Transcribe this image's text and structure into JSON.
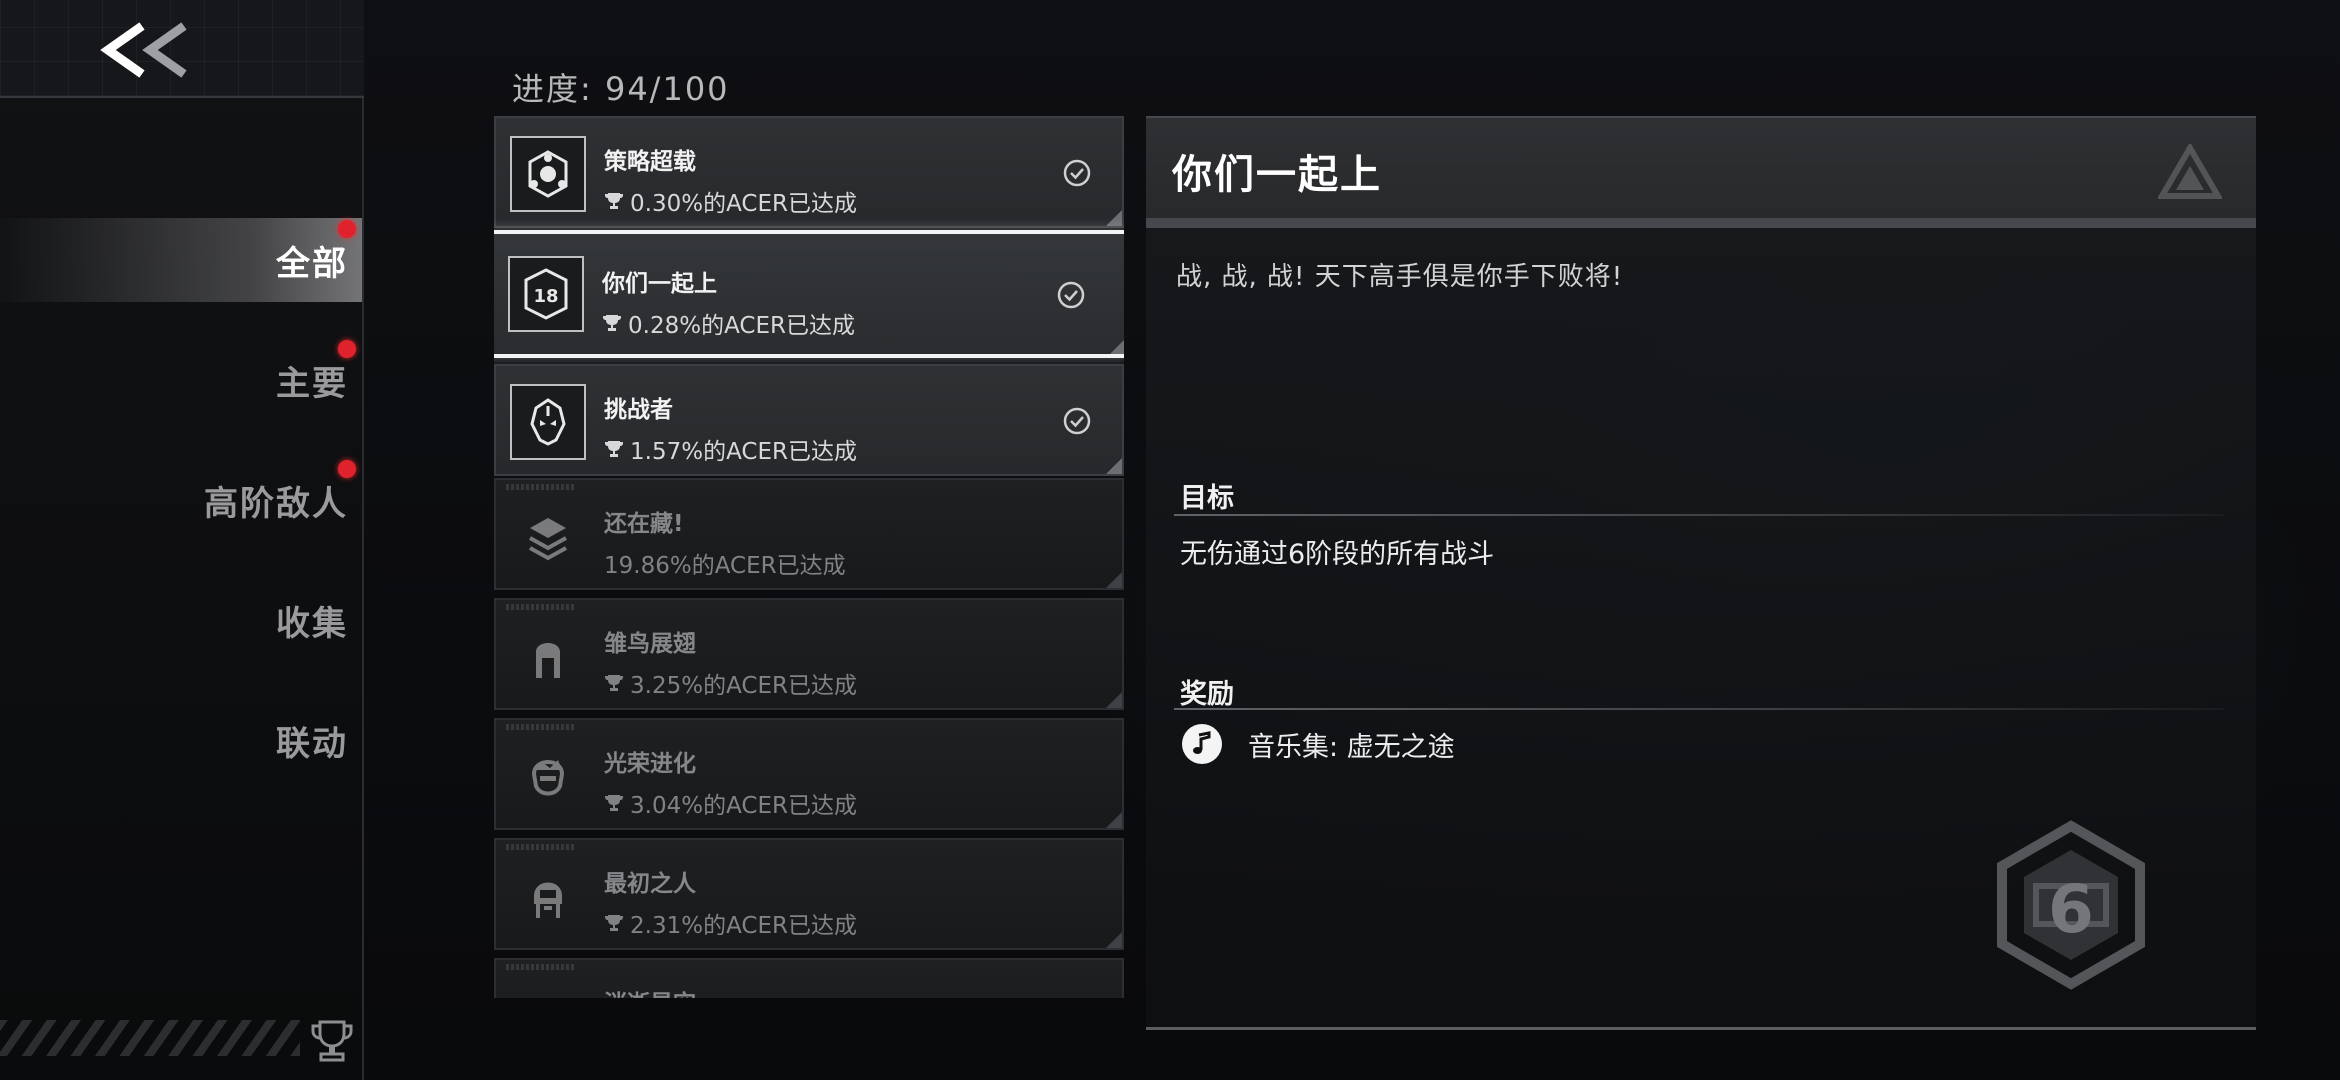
{
  "sidebar": {
    "back_glyph": "<<",
    "items": [
      {
        "label": "全部",
        "active": true,
        "has_dot": true
      },
      {
        "label": "主要",
        "active": false,
        "has_dot": true
      },
      {
        "label": "高阶敌人",
        "active": false,
        "has_dot": true
      },
      {
        "label": "收集",
        "active": false,
        "has_dot": false
      },
      {
        "label": "联动",
        "active": false,
        "has_dot": false
      }
    ],
    "footer_icon": "trophy-icon"
  },
  "progress": {
    "label": "进度: 94/100"
  },
  "achievements": [
    {
      "title": "策略超载",
      "rate": "0.30%的ACER已达成",
      "completed": true,
      "selected": false,
      "icon": "hex-emblem-icon"
    },
    {
      "title": "你们一起上",
      "rate": "0.28%的ACER已达成",
      "completed": true,
      "selected": true,
      "icon": "number-18-icon"
    },
    {
      "title": "挑战者",
      "rate": "1.57%的ACER已达成",
      "completed": true,
      "selected": false,
      "icon": "mask-icon"
    },
    {
      "title": "还在藏!",
      "rate": "19.86%的ACER已达成",
      "completed": false,
      "selected": false,
      "icon": "stack-icon"
    },
    {
      "title": "雏鸟展翅",
      "rate": "3.25%的ACER已达成",
      "completed": false,
      "selected": false,
      "icon": "portrait-girl-icon"
    },
    {
      "title": "光荣进化",
      "rate": "3.04%的ACER已达成",
      "completed": false,
      "selected": false,
      "icon": "portrait-boy-icon"
    },
    {
      "title": "最初之人",
      "rate": "2.31%的ACER已达成",
      "completed": false,
      "selected": false,
      "icon": "portrait-helmet-icon"
    },
    {
      "title": "消逝星空",
      "rate": "",
      "completed": false,
      "selected": false,
      "icon": "ring-icon"
    }
  ],
  "detail": {
    "title": "你们一起上",
    "description": "战, 战, 战! 天下高手俱是你手下败将!",
    "goal_label": "目标",
    "goal_text": "无伤通过6阶段的所有战斗",
    "reward_label": "奖励",
    "reward_text": "音乐集: 虚无之途",
    "reward_icon": "music-note-icon",
    "badge_number": "6"
  },
  "colors": {
    "accent_dot": "#e0222c",
    "selected_border": "#f2f4f6"
  }
}
